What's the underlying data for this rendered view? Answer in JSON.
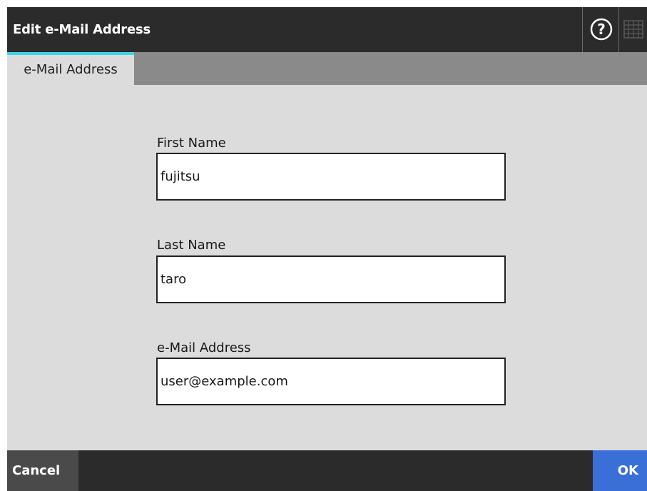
{
  "window": {
    "title": "Edit e-Mail Address",
    "help_icon": "help-icon",
    "keyboard_icon": "keyboard-icon"
  },
  "tabs": [
    {
      "label": "e-Mail Address",
      "active": true
    }
  ],
  "form": {
    "first_name": {
      "label": "First Name",
      "value": "fujitsu"
    },
    "last_name": {
      "label": "Last Name",
      "value": "taro"
    },
    "email": {
      "label": "e-Mail Address",
      "value": "user@example.com"
    }
  },
  "footer": {
    "cancel_label": "Cancel",
    "ok_label": "OK"
  },
  "colors": {
    "title_bar": "#2b2b2b",
    "tab_accent": "#3fd4e8",
    "ok_button": "#3a6fd8",
    "cancel_button": "#4a4a4a",
    "background": "#dcdcdc"
  }
}
